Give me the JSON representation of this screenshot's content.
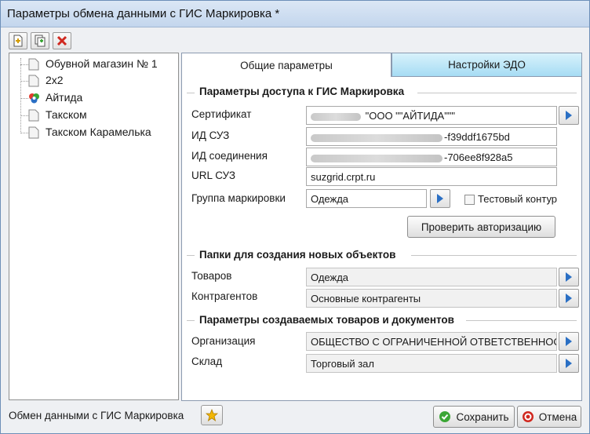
{
  "window": {
    "title": "Параметры обмена данными с ГИС Маркировка *"
  },
  "toolbar": [
    {
      "name": "add-icon",
      "tooltip": ""
    },
    {
      "name": "copy-icon",
      "tooltip": ""
    },
    {
      "name": "delete-icon",
      "tooltip": ""
    }
  ],
  "tree": {
    "items": [
      {
        "label": "Обувной магазин № 1",
        "icon": "document-icon"
      },
      {
        "label": "2x2",
        "icon": "document-icon"
      },
      {
        "label": "Айтида",
        "icon": "colored-settings-icon"
      },
      {
        "label": "Такском",
        "icon": "document-icon"
      },
      {
        "label": "Такском Карамелька",
        "icon": "document-icon"
      }
    ]
  },
  "tabs": [
    {
      "label": "Общие параметры",
      "active": true
    },
    {
      "label": "Настройки ЭДО",
      "active": false
    }
  ],
  "access_section": {
    "title": "Параметры доступа к ГИС Маркировка",
    "certificate": {
      "label": "Сертификат",
      "value": "\"ООО \"\"АЙТИДА\"\"\""
    },
    "suz_id": {
      "label": "ИД СУЗ",
      "value": "-f39ddf1675bd"
    },
    "connection_id": {
      "label": "ИД соединения",
      "value": "-706ee8f928a5"
    },
    "suz_url": {
      "label": "URL СУЗ",
      "value": "suzgrid.crpt.ru"
    },
    "marking_group": {
      "label": "Группа маркировки",
      "value": "Одежда"
    },
    "test_contour": {
      "label": "Тестовый контур",
      "checked": false
    },
    "check_auth_button": "Проверить авторизацию"
  },
  "folders_section": {
    "title": "Папки для создания новых объектов",
    "goods": {
      "label": "Товаров",
      "value": "Одежда"
    },
    "contractors": {
      "label": "Контрагентов",
      "value": "Основные контрагенты"
    }
  },
  "params_section": {
    "title": "Параметры создаваемых товаров и документов",
    "organization": {
      "label": "Организация",
      "value": "ОБЩЕСТВО С ОГРАНИЧЕННОЙ ОТВЕТСТВЕННОСТЬЮ"
    },
    "warehouse": {
      "label": "Склад",
      "value": "Торговый зал"
    }
  },
  "footer": {
    "status": "Обмен данными с ГИС Маркировка",
    "save_label": "Сохранить",
    "cancel_label": "Отмена"
  },
  "colors": {
    "accent": "#2a6fc4",
    "tab_inactive": "#a6dcf4",
    "save_icon": "#3aa635",
    "cancel_icon": "#d0281f"
  }
}
